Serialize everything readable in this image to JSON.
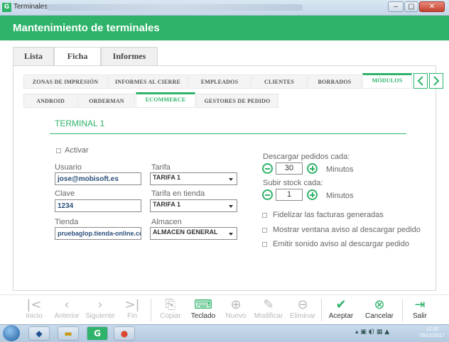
{
  "window": {
    "title": "Terminales",
    "app_icon": "G",
    "controls": [
      "–",
      "▢",
      "✕"
    ]
  },
  "header": {
    "title": "Mantenimiento de terminales",
    "color": "#2fb36a"
  },
  "main_tabs": [
    {
      "label": "Lista",
      "active": false
    },
    {
      "label": "Ficha",
      "active": true
    },
    {
      "label": "Informes",
      "active": false
    }
  ],
  "sub_tabs_row1": [
    {
      "label": "ZONAS DE IMPRESIÓN",
      "active": false
    },
    {
      "label": "INFORMES AL CIERRE",
      "active": false
    },
    {
      "label": "EMPLEADOS",
      "active": false
    },
    {
      "label": "CLIENTES",
      "active": false
    },
    {
      "label": "BORRADOS",
      "active": false
    },
    {
      "label": "MÓDULOS",
      "active": true
    }
  ],
  "sub_tabs_row2": [
    {
      "label": "ANDROID",
      "active": false
    },
    {
      "label": "ORDERMAN",
      "active": false
    },
    {
      "label": "ECOMMERCE",
      "active": true
    },
    {
      "label": "GESTORES DE PEDIDO",
      "active": false
    }
  ],
  "nav_arrows": {
    "prev": "chevron-left-icon",
    "next": "chevron-right-icon"
  },
  "form": {
    "section_title": "TERMINAL 1",
    "activar": {
      "label": "Activar",
      "checked": false
    },
    "usuario": {
      "label": "Usuario",
      "value": "jose@mobisoft.es"
    },
    "clave": {
      "label": "Clave",
      "value": "1234"
    },
    "tienda": {
      "label": "Tienda",
      "value": "pruebaglop.tienda-online.com"
    },
    "tarifa": {
      "label": "Tarifa",
      "value": "TARIFA 1"
    },
    "tarifa_tienda": {
      "label": "Tarifa en tienda",
      "value": "TARIFA 1"
    },
    "almacen": {
      "label": "Almacen",
      "value": "ALMACEN GENERAL"
    },
    "descargar": {
      "label": "Descargar pedidos cada:",
      "value": "30",
      "unit": "Minutos"
    },
    "subir": {
      "label": "Subir stock cada:",
      "value": "1",
      "unit": "Minutos"
    },
    "options": [
      {
        "label": "Fidelizar las facturas generadas",
        "checked": false
      },
      {
        "label": "Mostrar ventana aviso al descargar pedido",
        "checked": false
      },
      {
        "label": "Emitir sonido aviso al descargar pedido",
        "checked": false
      }
    ]
  },
  "toolbar": {
    "inicio": "Inicio",
    "anterior": "Anterior",
    "siguiente": "Siguiente",
    "fin": "Fin",
    "copiar": "Copiar",
    "teclado": "Teclado",
    "nuevo": "Nuevo",
    "modificar": "Modificar",
    "eliminar": "Eliminar",
    "aceptar": "Aceptar",
    "cancelar": "Cancelar",
    "salir": "Salir"
  },
  "taskbar": {
    "time": "12:32",
    "date": "05/10/2017"
  }
}
